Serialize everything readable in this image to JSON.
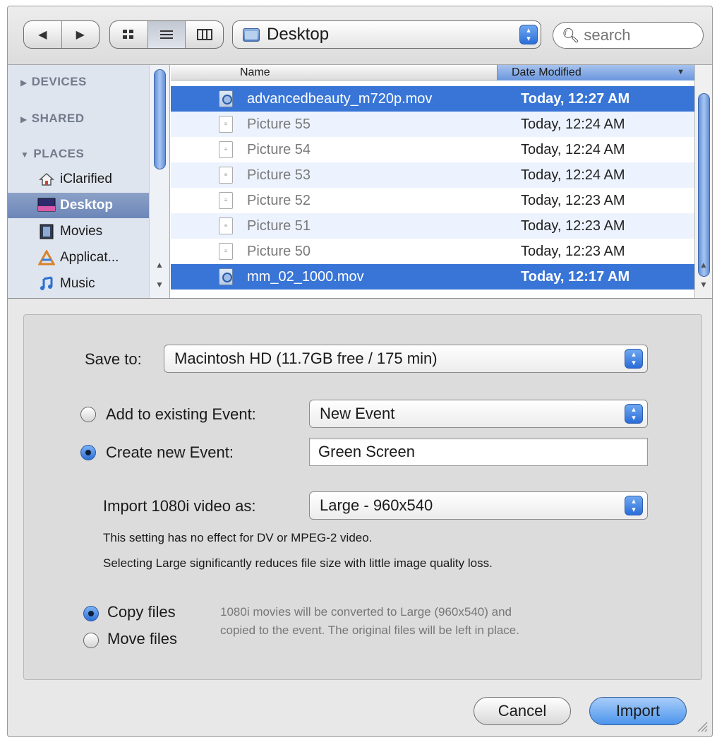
{
  "toolbar": {
    "back_icon": "triangle-left",
    "forward_icon": "triangle-right",
    "view_modes": [
      "icon-view",
      "list-view",
      "column-view"
    ],
    "location": "Desktop",
    "search_placeholder": "search"
  },
  "sidebar": {
    "devices_label": "DEVICES",
    "shared_label": "SHARED",
    "places_label": "PLACES",
    "places": [
      {
        "label": "iClarified",
        "icon": "home-icon",
        "selected": false
      },
      {
        "label": "Desktop",
        "icon": "desktop-icon",
        "selected": true
      },
      {
        "label": "Movies",
        "icon": "movies-icon",
        "selected": false
      },
      {
        "label": "Applicat...",
        "icon": "applications-icon",
        "selected": false
      },
      {
        "label": "Music",
        "icon": "music-icon",
        "selected": false
      }
    ]
  },
  "file_list": {
    "columns": [
      "Name",
      "Date Modified"
    ],
    "rows": [
      {
        "name": "advancedbeauty_m720p.mov",
        "date": "Today, 12:27 AM",
        "selected": true,
        "kind": "movie"
      },
      {
        "name": "Picture 55",
        "date": "Today, 12:24 AM",
        "selected": false,
        "kind": "picture"
      },
      {
        "name": "Picture 54",
        "date": "Today, 12:24 AM",
        "selected": false,
        "kind": "picture"
      },
      {
        "name": "Picture 53",
        "date": "Today, 12:24 AM",
        "selected": false,
        "kind": "picture"
      },
      {
        "name": "Picture 52",
        "date": "Today, 12:23 AM",
        "selected": false,
        "kind": "picture"
      },
      {
        "name": "Picture 51",
        "date": "Today, 12:23 AM",
        "selected": false,
        "kind": "picture"
      },
      {
        "name": "Picture 50",
        "date": "Today, 12:23 AM",
        "selected": false,
        "kind": "picture"
      },
      {
        "name": "mm_02_1000.mov",
        "date": "Today, 12:17 AM",
        "selected": true,
        "kind": "movie"
      }
    ]
  },
  "options": {
    "save_to_label": "Save to:",
    "save_to_value": "Macintosh HD (11.7GB free / 175 min)",
    "add_existing_label": "Add to existing Event:",
    "add_existing_value": "New Event",
    "create_new_label": "Create new Event:",
    "create_new_value": "Green Screen",
    "import_label": "Import 1080i video as:",
    "import_value": "Large - 960x540",
    "hint_1": "This setting has no effect for DV or MPEG-2 video.",
    "hint_2": "Selecting Large significantly reduces file size with little image quality loss.",
    "copy_label": "Copy files",
    "move_label": "Move files",
    "note_1": "1080i movies will be converted to Large (960x540) and",
    "note_2": "copied to the event. The original files will be left in place."
  },
  "buttons": {
    "cancel": "Cancel",
    "import": "Import"
  },
  "colors": {
    "selection": "#3875d7",
    "accent": "#4c95ec"
  }
}
